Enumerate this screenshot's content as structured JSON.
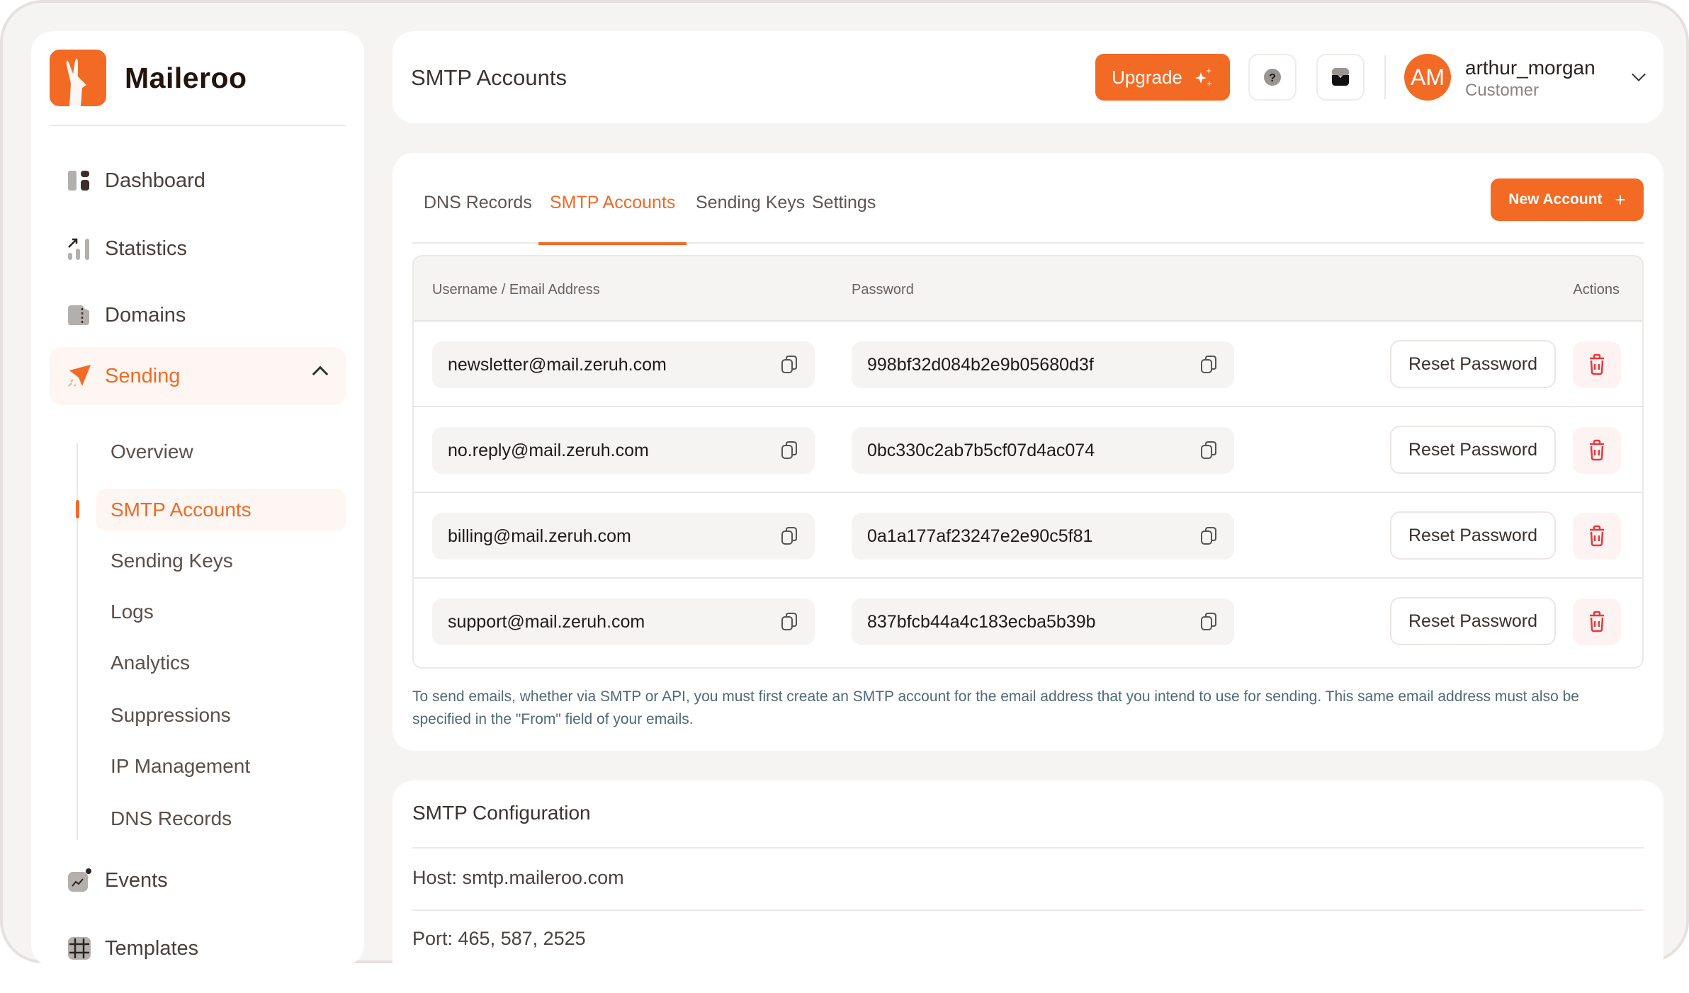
{
  "brand": {
    "name": "Maileroo",
    "accent_color": "#f26a24"
  },
  "sidebar": {
    "items": [
      {
        "label": "Dashboard",
        "icon": "dashboard-icon"
      },
      {
        "label": "Statistics",
        "icon": "statistics-icon"
      },
      {
        "label": "Domains",
        "icon": "domains-icon"
      },
      {
        "label": "Sending",
        "icon": "paper-plane-icon",
        "expanded": true,
        "active": true
      },
      {
        "label": "Events",
        "icon": "events-icon"
      },
      {
        "label": "Templates",
        "icon": "templates-icon"
      }
    ],
    "sending_subitems": [
      {
        "label": "Overview"
      },
      {
        "label": "SMTP Accounts",
        "active": true
      },
      {
        "label": "Sending Keys"
      },
      {
        "label": "Logs"
      },
      {
        "label": "Analytics"
      },
      {
        "label": "Suppressions"
      },
      {
        "label": "IP Management"
      },
      {
        "label": "DNS Records"
      }
    ]
  },
  "header": {
    "title": "SMTP Accounts",
    "upgrade_label": "Upgrade",
    "help_icon": "help-icon",
    "inbox_icon": "inbox-icon",
    "user": {
      "initials": "AM",
      "name": "arthur_morgan",
      "role": "Customer"
    }
  },
  "main": {
    "tabs": [
      {
        "label": "DNS Records"
      },
      {
        "label": "SMTP Accounts",
        "active": true
      },
      {
        "label": "Sending Keys"
      },
      {
        "label": "Settings"
      }
    ],
    "new_account_label": "New Account",
    "table": {
      "columns": [
        "Username / Email Address",
        "Password",
        "Actions"
      ],
      "rows": [
        {
          "email": "newsletter@mail.zeruh.com",
          "password": "998bf32d084b2e9b05680d3f",
          "action": "Reset Password"
        },
        {
          "email": "no.reply@mail.zeruh.com",
          "password": "0bc330c2ab7b5cf07d4ac074",
          "action": "Reset Password"
        },
        {
          "email": "billing@mail.zeruh.com",
          "password": "0a1a177af23247e2e90c5f81",
          "action": "Reset Password"
        },
        {
          "email": "support@mail.zeruh.com",
          "password": "837bfcb44a4c183ecba5b39b",
          "action": "Reset Password"
        }
      ]
    },
    "note": "To send emails, whether via SMTP or API, you must first create an SMTP account for the email address that you intend to use for sending. This same email address must also be specified in the \"From\" field of your emails."
  },
  "config": {
    "title": "SMTP Configuration",
    "host": "Host: smtp.maileroo.com",
    "port": "Port: 465, 587, 2525"
  }
}
